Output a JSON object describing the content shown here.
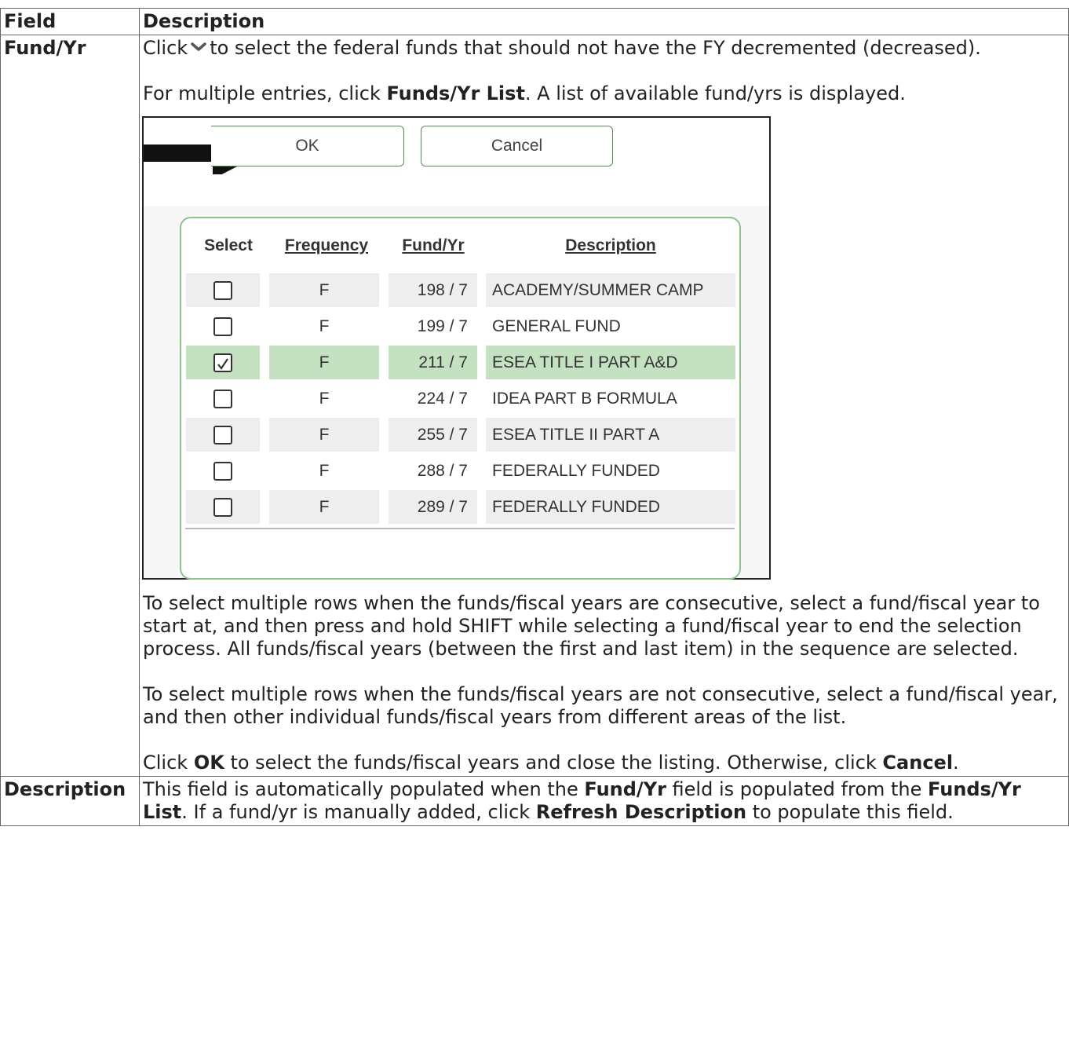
{
  "table": {
    "header_field": "Field",
    "header_description": "Description"
  },
  "fund_row": {
    "label": "Fund/Yr",
    "p1_click": "Click",
    "p1_rest": "to select the federal funds that should not have the FY decremented (decreased).",
    "p2_a": "For multiple entries, click ",
    "p2_b": "Funds/Yr List",
    "p2_c": ". A list of available fund/yrs is displayed.",
    "p3": "To select multiple rows when the funds/fiscal years are consecutive, select a fund/fiscal year to start at, and then press and hold SHIFT while selecting a fund/fiscal year to end the selection process. All funds/fiscal years (between the first and last item) in the sequence are selected.",
    "p4": "To select multiple rows when the funds/fiscal years are not consecutive, select a fund/fiscal year, and then other individual funds/fiscal years from different areas of the list.",
    "p5_a": "Click ",
    "p5_b": "OK",
    "p5_c": " to select the funds/fiscal years and close the listing. Otherwise, click ",
    "p5_d": "Cancel",
    "p5_e": "."
  },
  "desc_row": {
    "label": "Description",
    "t_a": "This field is automatically populated when the ",
    "t_b": "Fund/Yr",
    "t_c": " field is populated from the ",
    "t_d": "Funds/Yr List",
    "t_e": ". If a fund/yr is manually added, click ",
    "t_f": "Refresh Description",
    "t_g": " to populate this field."
  },
  "dialog": {
    "ok_label": "OK",
    "cancel_label": "Cancel",
    "columns": [
      "Select",
      "Frequency",
      "Fund/Yr",
      "Description"
    ],
    "rows": [
      {
        "checked": false,
        "frequency": "F",
        "fund": "198 / 7",
        "description": "ACADEMY/SUMMER CAMP"
      },
      {
        "checked": false,
        "frequency": "F",
        "fund": "199 / 7",
        "description": "GENERAL FUND"
      },
      {
        "checked": true,
        "frequency": "F",
        "fund": "211 / 7",
        "description": "ESEA TITLE I PART A&D"
      },
      {
        "checked": false,
        "frequency": "F",
        "fund": "224 / 7",
        "description": "IDEA PART B FORMULA"
      },
      {
        "checked": false,
        "frequency": "F",
        "fund": "255 / 7",
        "description": "ESEA TITLE II PART A"
      },
      {
        "checked": false,
        "frequency": "F",
        "fund": "288 / 7",
        "description": "FEDERALLY FUNDED"
      },
      {
        "checked": false,
        "frequency": "F",
        "fund": "289 / 7",
        "description": "FEDERALLY FUNDED"
      }
    ]
  },
  "icons": {
    "dropdown": "chevron-down-icon",
    "arrow": "arrow-right-icon",
    "checkbox": "checkbox-icon"
  },
  "colors": {
    "selected_row": "#c4e1c1",
    "panel_border": "#8cc48c",
    "button_border": "#5a8a5a"
  }
}
